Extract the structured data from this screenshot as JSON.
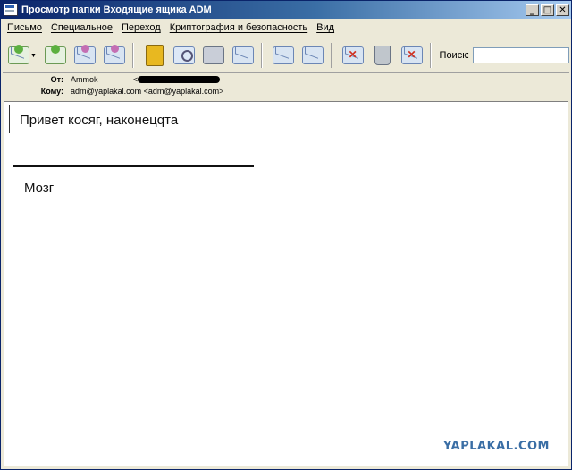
{
  "window": {
    "title": "Просмотр папки Входящие ящика ADM",
    "buttons": {
      "minimize": "_",
      "maximize": "□",
      "close": "✕"
    }
  },
  "menu": [
    "Письмо",
    "Специальное",
    "Переход",
    "Криптография и безопасность",
    "Вид"
  ],
  "toolbar": {
    "icons": [
      "get-mail-icon",
      "reply-icon",
      "forward-icon",
      "send-icon",
      "address-book-icon",
      "search-icon",
      "print-icon",
      "save-icon",
      "move-up-icon",
      "move-down-icon",
      "mark-icon",
      "trash-icon",
      "delete-icon"
    ],
    "search_label": "Поиск:",
    "search_value": ""
  },
  "header": {
    "from_label": "От:",
    "from_name": "Ammok",
    "from_email_open": "<",
    "to_label": "Кому:",
    "to_value": "adm@yaplakal.com <adm@yaplakal.com>"
  },
  "body": {
    "line1": "Привет косяг, наконецqта",
    "line2": "Мозг"
  },
  "watermark": "YAPLAKAL.COM"
}
